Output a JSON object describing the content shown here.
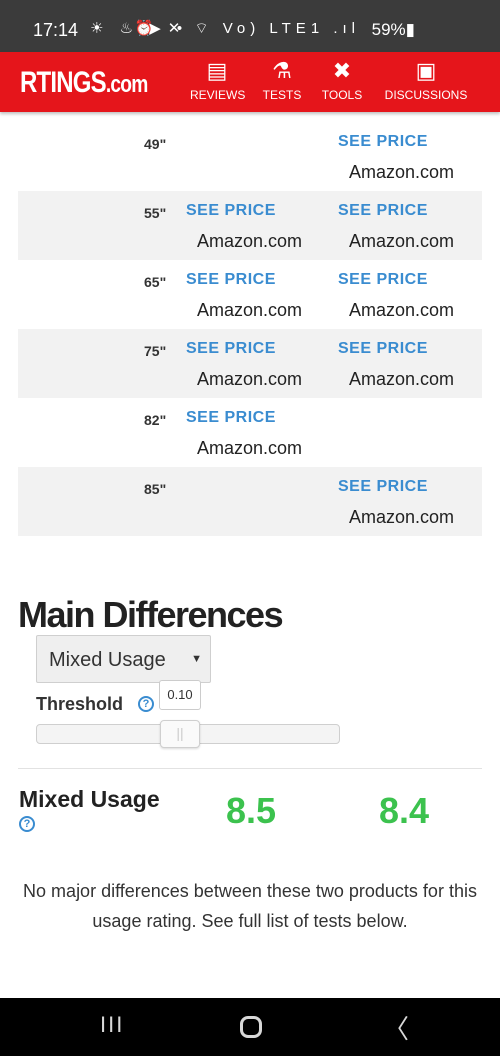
{
  "status_bar": {
    "time": "17:14",
    "left_icons": "☀ ♨ ▶ •",
    "right_icons": "⏰ ✕ ⌔ Vo) LTE1 .ıl",
    "battery": "59%▮"
  },
  "header": {
    "logo": "RTINGS",
    "logo_suffix": ".com",
    "nav": [
      {
        "label": "REVIEWS",
        "icon": "clipboard-icon",
        "glyph": "▤"
      },
      {
        "label": "TESTS",
        "icon": "flask-icon",
        "glyph": "⚗"
      },
      {
        "label": "TOOLS",
        "icon": "tools-icon",
        "glyph": "✖"
      },
      {
        "label": "DISCUSSIONS",
        "icon": "chat-icon",
        "glyph": "▣"
      }
    ],
    "brand_color": "#e5151b"
  },
  "price_table": {
    "link_label": "SEE PRICE",
    "rows": [
      {
        "size": "49\"",
        "col1": "",
        "col1_store": "",
        "col2": "SEE PRICE",
        "col2_store": "Amazon.com"
      },
      {
        "size": "55\"",
        "col1": "SEE PRICE",
        "col1_store": "Amazon.com",
        "col2": "SEE PRICE",
        "col2_store": "Amazon.com"
      },
      {
        "size": "65\"",
        "col1": "SEE PRICE",
        "col1_store": "Amazon.com",
        "col2": "SEE PRICE",
        "col2_store": "Amazon.com"
      },
      {
        "size": "75\"",
        "col1": "SEE PRICE",
        "col1_store": "Amazon.com",
        "col2": "SEE PRICE",
        "col2_store": "Amazon.com"
      },
      {
        "size": "82\"",
        "col1": "SEE PRICE",
        "col1_store": "Amazon.com",
        "col2": "",
        "col2_store": ""
      },
      {
        "size": "85\"",
        "col1": "",
        "col1_store": "",
        "col2": "SEE PRICE",
        "col2_store": "Amazon.com"
      }
    ]
  },
  "main_differences": {
    "title": "Main Differences",
    "select_value": "Mixed Usage",
    "select_arrow": "▼",
    "threshold_label": "Threshold",
    "help_glyph": "?",
    "threshold_value": "0.10",
    "slider_fraction": 0.47,
    "usage_title": "Mixed Usage",
    "score_1": "8.5",
    "score_2": "8.4",
    "score_color": "#3cc24e",
    "note": "No major differences between these two products for this usage rating. See full list of tests below."
  },
  "nav_bar": {
    "recent": "III",
    "back": "〈"
  }
}
